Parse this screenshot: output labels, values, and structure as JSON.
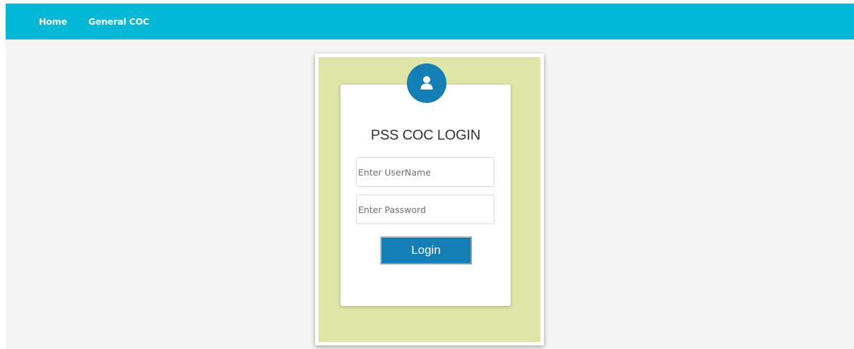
{
  "nav": {
    "items": [
      {
        "label": "Home"
      },
      {
        "label": "General COC"
      }
    ]
  },
  "login": {
    "avatar_icon": "user-icon",
    "title": "PSS COC LOGIN",
    "username_placeholder": "Enter UserName",
    "username_value": "",
    "password_placeholder": "Enter Password",
    "password_value": "",
    "button_label": "Login"
  },
  "colors": {
    "navbar": "#03b8d6",
    "page_background": "#f4f4f4",
    "frame_background": "#dfe4a7",
    "accent": "#147fb4"
  }
}
